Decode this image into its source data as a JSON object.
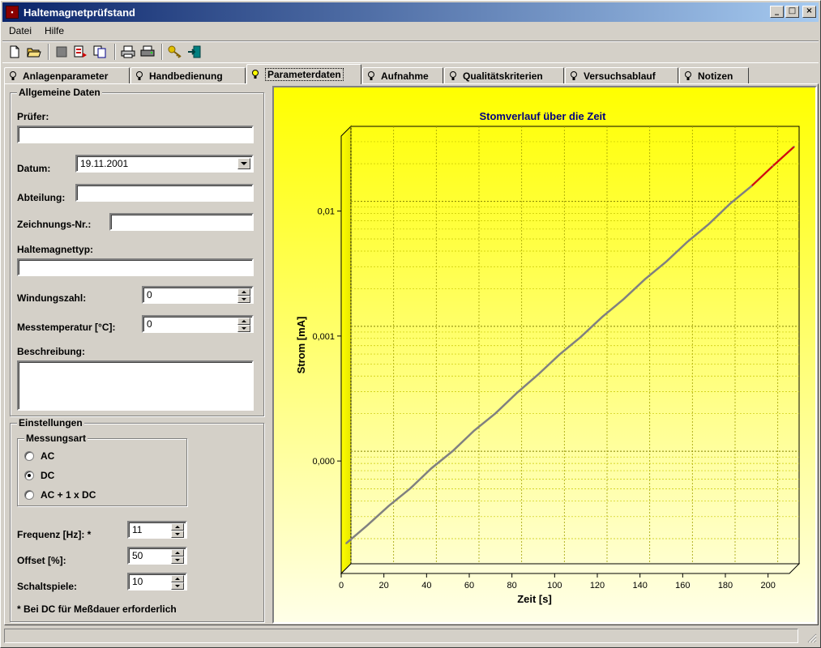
{
  "window": {
    "title": "Haltemagnetprüfstand",
    "buttons": {
      "minimize": "_",
      "maximize": "□",
      "close": "×"
    }
  },
  "menu": {
    "items": [
      {
        "label": "Datei"
      },
      {
        "label": "Hilfe"
      }
    ]
  },
  "toolbar": {
    "icons": [
      "new-file-icon",
      "open-folder-icon",
      "stop-icon",
      "export-icon",
      "copy-icon",
      "print-icon",
      "printer-setup-icon",
      "key-icon",
      "exit-icon"
    ]
  },
  "tabs": [
    {
      "label": "Anlagenparameter",
      "active": false
    },
    {
      "label": "Handbedienung",
      "active": false
    },
    {
      "label": "Parameterdaten",
      "active": true
    },
    {
      "label": "Aufnahme",
      "active": false
    },
    {
      "label": "Qualitätskriterien",
      "active": false
    },
    {
      "label": "Versuchsablauf",
      "active": false
    },
    {
      "label": "Notizen",
      "active": false
    }
  ],
  "general": {
    "title": "Allgemeine Daten",
    "pruefer_label": "Prüfer:",
    "pruefer_value": "",
    "datum_label": "Datum:",
    "datum_value": "19.11.2001",
    "abteilung_label": "Abteilung:",
    "abteilung_value": "",
    "zeichnung_label": "Zeichnungs-Nr.:",
    "zeichnung_value": "",
    "typ_label": "Haltemagnettyp:",
    "typ_value": "",
    "windungen_label": "Windungszahl:",
    "windungen_value": "0",
    "temp_label": "Messtemperatur [°C]:",
    "temp_value": "0",
    "beschreibung_label": "Beschreibung:",
    "beschreibung_value": ""
  },
  "settings": {
    "title": "Einstellungen",
    "messungsart_title": "Messungsart",
    "modes": [
      {
        "label": "AC",
        "selected": false
      },
      {
        "label": "DC",
        "selected": true
      },
      {
        "label": "AC + 1 x DC",
        "selected": false
      }
    ],
    "frequenz_label": "Frequenz [Hz]: *",
    "frequenz_value": "11",
    "offset_label": "Offset [%]:",
    "offset_value": "50",
    "schaltspiele_label": "Schaltspiele:",
    "schaltspiele_value": "10",
    "footnote": "* Bei DC für Meßdauer erforderlich"
  },
  "chart_data": {
    "type": "line",
    "title": "Stomverlauf über die Zeit",
    "xlabel": "Zeit [s]",
    "ylabel": "Strom [mA]",
    "x_ticks": [
      "0",
      "20",
      "40",
      "60",
      "80",
      "100",
      "120",
      "140",
      "160",
      "180",
      "200"
    ],
    "y_ticks": [
      "0,000",
      "0,001",
      "0,01"
    ],
    "xlim": [
      0,
      210
    ],
    "y_scale": "log",
    "grid": true,
    "background": "yellow-gradient",
    "series": [
      {
        "color": "#808080",
        "highlight_color": "#e00000",
        "x": [
          0,
          10,
          20,
          30,
          40,
          50,
          60,
          70,
          80,
          90,
          100,
          110,
          120,
          130,
          140,
          150,
          160,
          170,
          180,
          190,
          200,
          210
        ],
        "y": [
          2e-05,
          2.8e-05,
          4e-05,
          5.5e-05,
          8e-05,
          0.00011,
          0.00016,
          0.00022,
          0.00032,
          0.00045,
          0.00065,
          0.0009,
          0.0013,
          0.0018,
          0.0026,
          0.0036,
          0.0052,
          0.0072,
          0.0105,
          0.0145,
          0.021,
          0.03
        ]
      }
    ]
  }
}
